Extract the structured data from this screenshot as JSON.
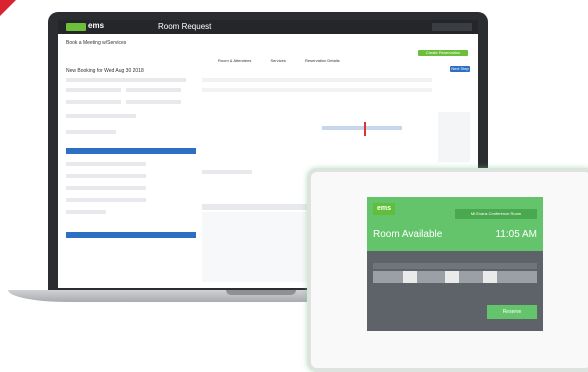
{
  "laptop": {
    "app_name": "ems",
    "window_title": "Room Request",
    "breadcrumb": "Book a Meeting w/Services",
    "tabs": [
      "Room & Attendees",
      "Services",
      "Reservation Details"
    ],
    "booking_title": "New Booking for Wed Aug 30 2018",
    "buttons": [
      "Create Reservation",
      "Next Step"
    ]
  },
  "tablet": {
    "logo": "ems",
    "room_name": "Mt Evans Conference Room",
    "status": "Room Available",
    "time": "11:05 AM",
    "reserve_label": "Reserve"
  }
}
